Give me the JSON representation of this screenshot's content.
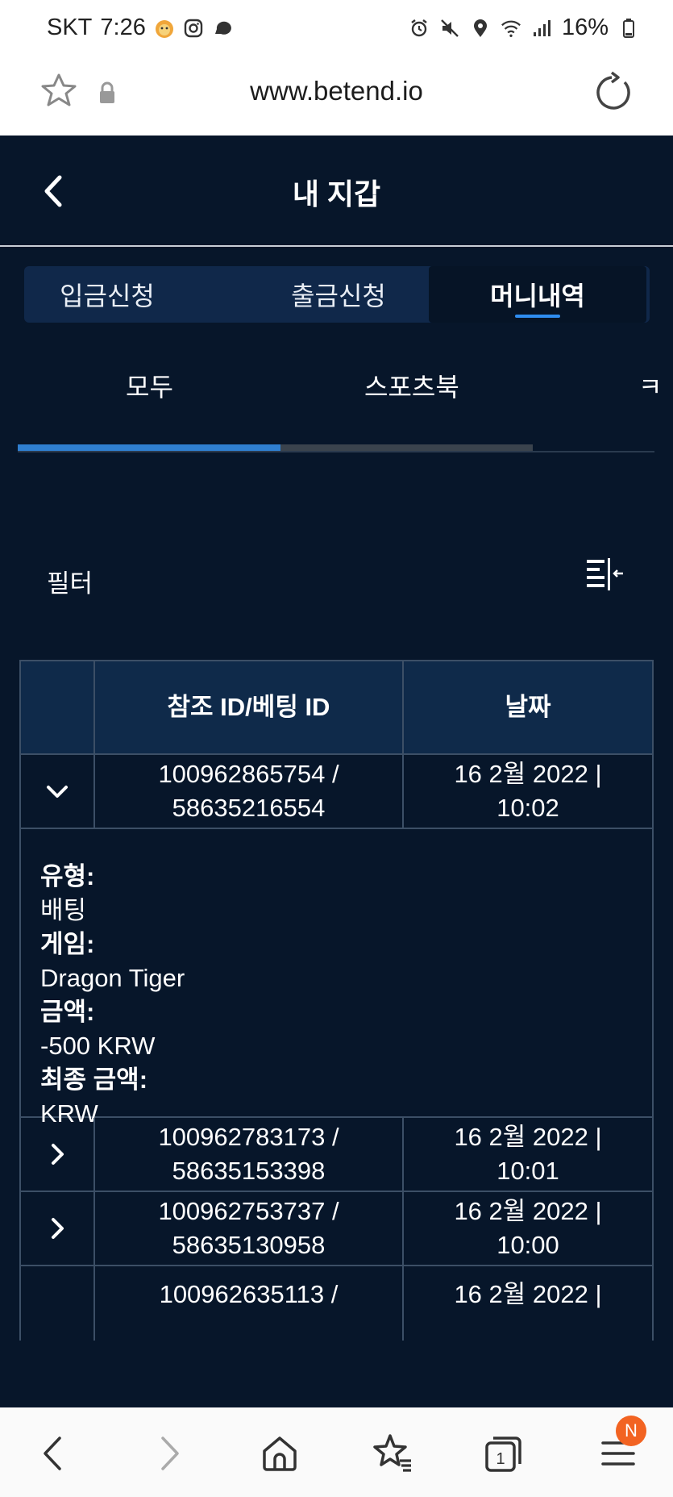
{
  "status_bar": {
    "carrier": "SKT",
    "time": "7:26",
    "battery": "16%"
  },
  "browser": {
    "url": "www.betend.io"
  },
  "header": {
    "title": "내 지갑"
  },
  "wallet_tabs": [
    {
      "label": "입금신청"
    },
    {
      "label": "출금신청"
    },
    {
      "label": "머니내역"
    }
  ],
  "category_tabs": [
    {
      "label": "모두"
    },
    {
      "label": "스포츠북"
    },
    {
      "label": "ㅋ"
    }
  ],
  "filter": {
    "label": "필터"
  },
  "table": {
    "headers": [
      "",
      "참조 ID/베팅 ID",
      "날짜"
    ],
    "rows": [
      {
        "ref_id": "100962865754 /",
        "bet_id": "58635216554",
        "date": "16 2월 2022 |",
        "time": "10:02",
        "expanded": true
      },
      {
        "ref_id": "100962783173 /",
        "bet_id": "58635153398",
        "date": "16 2월 2022 |",
        "time": "10:01",
        "expanded": false
      },
      {
        "ref_id": "100962753737 /",
        "bet_id": "58635130958",
        "date": "16 2월 2022 |",
        "time": "10:00",
        "expanded": false
      },
      {
        "ref_id": "100962635113 /",
        "bet_id": "",
        "date": "16 2월 2022 |",
        "time": "",
        "expanded": false
      }
    ],
    "detail": {
      "type_label": "유형:",
      "type_value": "배팅",
      "game_label": "게임:",
      "game_value": "Dragon Tiger",
      "amount_label": "금액:",
      "amount_value": "-500 KRW",
      "final_label": "최종 금액:",
      "final_value": "KRW"
    }
  },
  "bottom_nav": {
    "tab_count": "1",
    "badge": "N"
  },
  "colors": {
    "app_bg": "#07162a",
    "accent": "#2f8df0",
    "badge": "#f26322"
  }
}
